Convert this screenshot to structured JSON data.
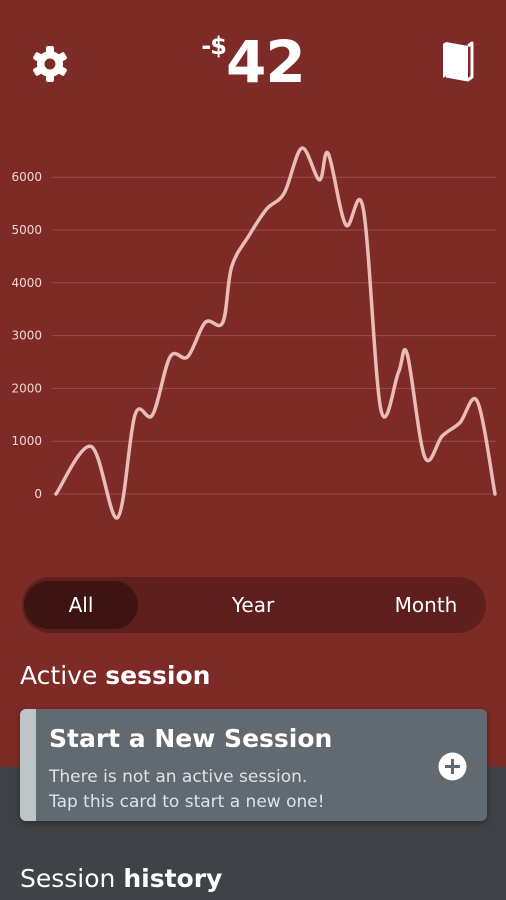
{
  "header": {
    "settings_icon": "gear-icon",
    "balance_sign": "-$",
    "balance_amount": "42",
    "book_icon": "book-icon"
  },
  "colors": {
    "background_top": "#7e2a26",
    "background_bottom": "#3f4246",
    "line": "#e8bdb8",
    "card": "#616a71"
  },
  "chart_data": {
    "type": "line",
    "yticks": [
      "0",
      "1000",
      "2000",
      "3000",
      "4000",
      "5000",
      "6000"
    ],
    "ylim": [
      0,
      6000
    ],
    "grid": true,
    "x": [
      0,
      4,
      7,
      9,
      11,
      13,
      15,
      17,
      19,
      20,
      22,
      24,
      26,
      28,
      30,
      31,
      33,
      35,
      37,
      39,
      40,
      42,
      44,
      46,
      48,
      50
    ],
    "series": [
      {
        "values": [
          0,
          900,
          -450,
          1500,
          1500,
          2600,
          2600,
          3250,
          3250,
          4300,
          4900,
          5400,
          5700,
          6550,
          5950,
          6450,
          5100,
          5400,
          1600,
          2300,
          2650,
          700,
          1100,
          1350,
          1750,
          0
        ]
      }
    ]
  },
  "range_tabs": {
    "all": "All",
    "year": "Year",
    "month": "Month",
    "selected": "All"
  },
  "active_section": {
    "title_regular": "Active ",
    "title_bold": "session"
  },
  "card": {
    "title": "Start a New Session",
    "line1": "There is not an active session.",
    "line2": "Tap this card to start a new one!",
    "action_icon": "plus-circle-icon"
  },
  "history_section": {
    "title_regular": "Session ",
    "title_bold": "history"
  }
}
